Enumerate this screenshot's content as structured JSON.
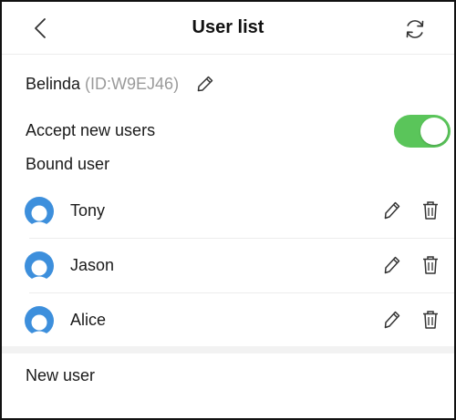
{
  "header": {
    "title": "User list",
    "back_icon": "chevron-left-icon",
    "refresh_icon": "refresh-icon"
  },
  "owner": {
    "name": "Belinda",
    "id_text": "(ID:W9EJ46)",
    "edit_icon": "pencil-icon"
  },
  "settings": {
    "accept_label": "Accept new users",
    "accept_enabled": true,
    "toggle_color": "#5ac55a"
  },
  "bound": {
    "label": "Bound user",
    "users": [
      {
        "name": "Tony"
      },
      {
        "name": "Jason"
      },
      {
        "name": "Alice"
      }
    ],
    "avatar_color": "#3d8fdc"
  },
  "new_user": {
    "label": "New user"
  }
}
